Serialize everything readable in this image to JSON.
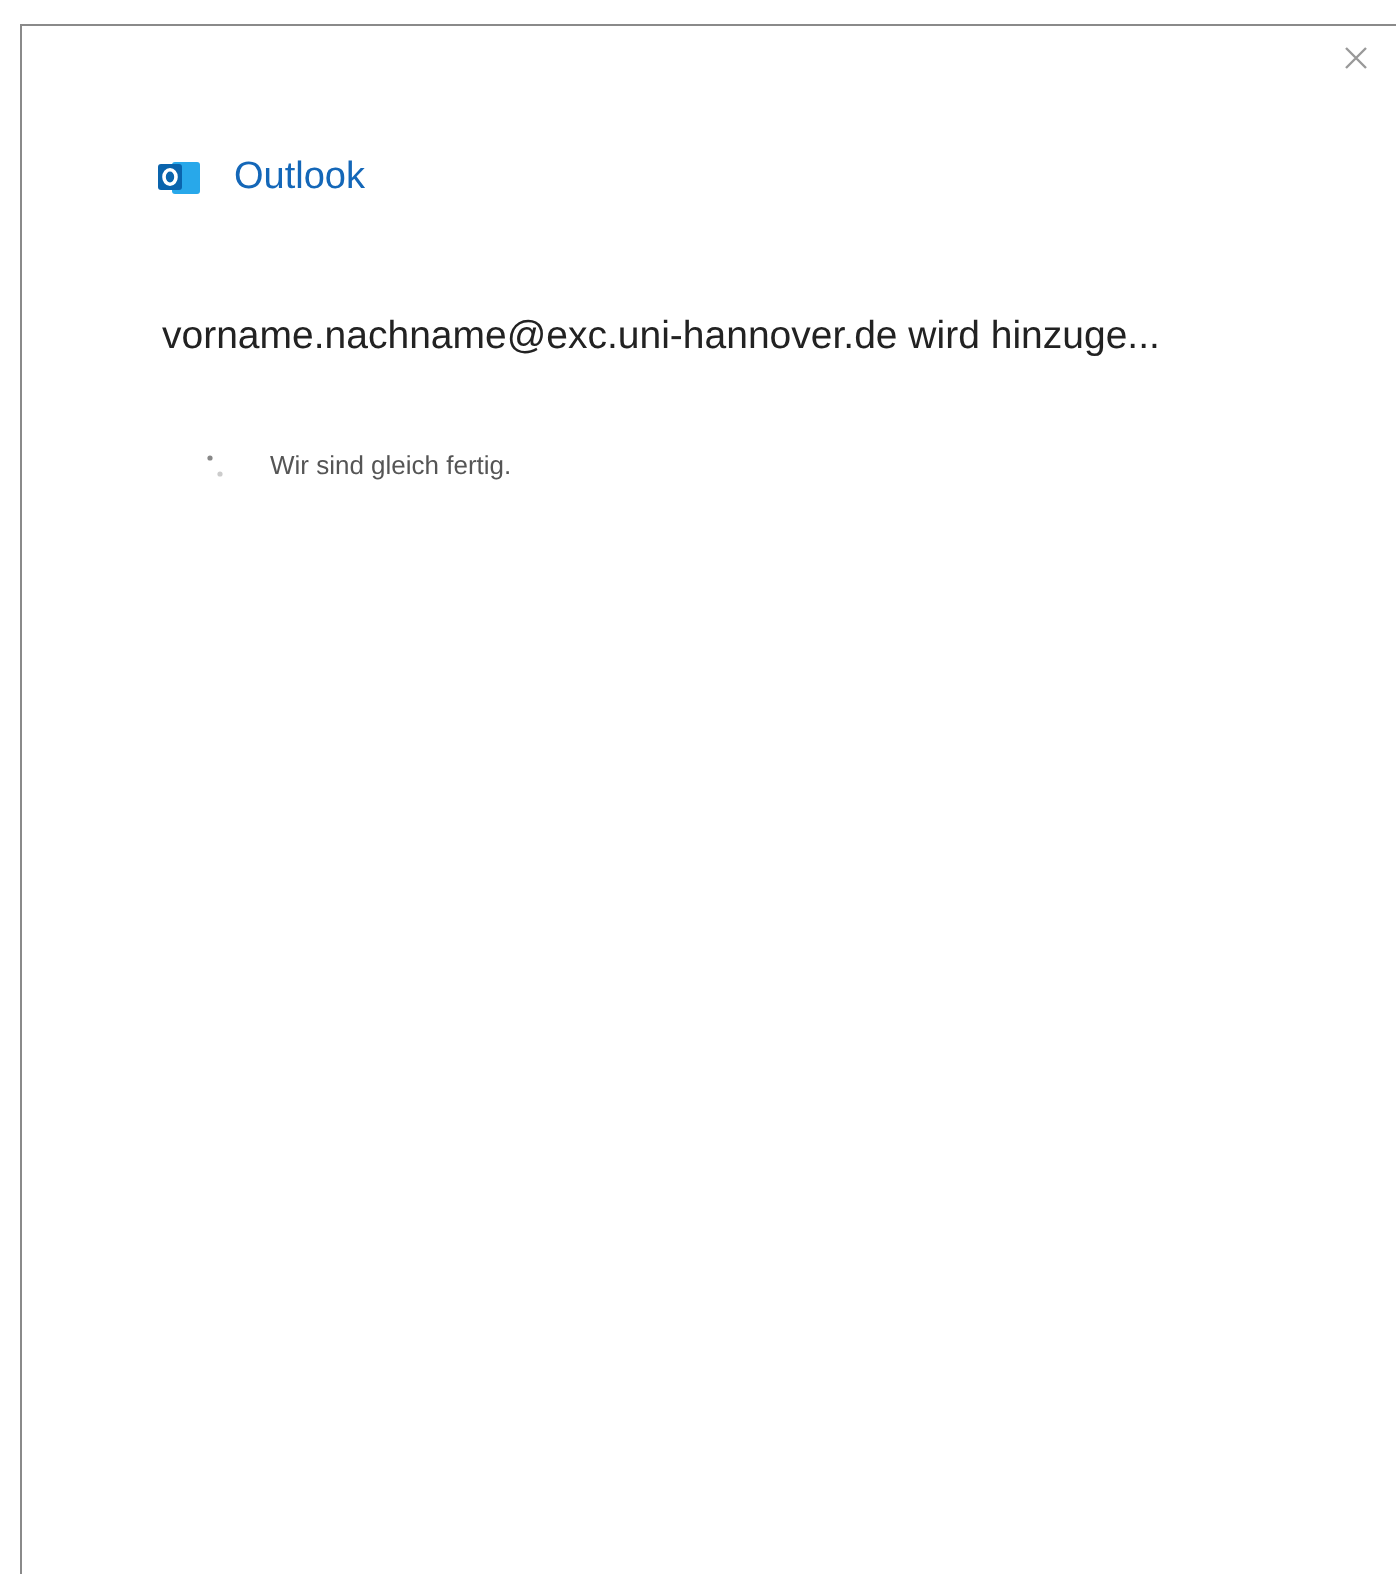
{
  "app": {
    "name": "Outlook"
  },
  "heading": "vorname.nachname@exc.uni-hannover.de wird hinzuge...",
  "status": {
    "text": "Wir sind gleich fertig."
  }
}
